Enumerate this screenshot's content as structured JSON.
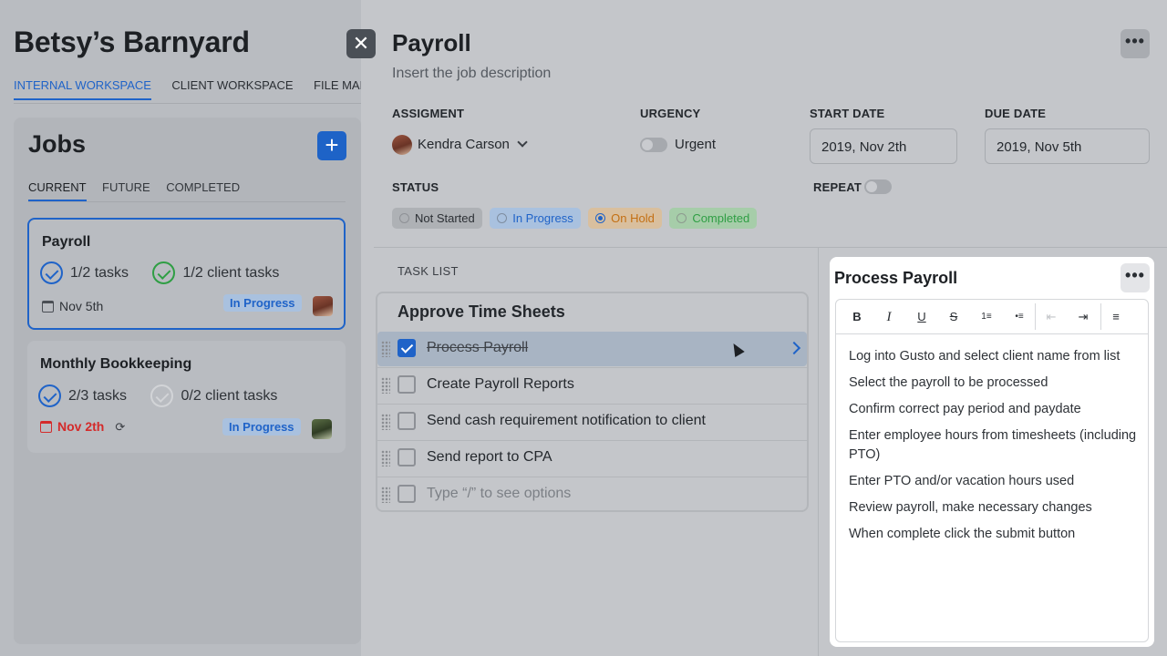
{
  "company": {
    "name": "Betsy’s Barnyard"
  },
  "workspace_tabs": [
    {
      "label": "INTERNAL WORKSPACE",
      "active": true
    },
    {
      "label": "CLIENT WORKSPACE",
      "active": false
    },
    {
      "label": "FILE MANAGER",
      "active": false
    }
  ],
  "jobs": {
    "title": "Jobs",
    "add_icon": "plus-icon",
    "tabs": [
      {
        "label": "CURRENT",
        "active": true
      },
      {
        "label": "FUTURE",
        "active": false
      },
      {
        "label": "COMPLETED",
        "active": false
      }
    ],
    "cards": [
      {
        "name": "Payroll",
        "tasks": "1/2 tasks",
        "client_tasks": "1/2 client tasks",
        "date": "Nov 5th",
        "status": "In Progress",
        "selected": true
      },
      {
        "name": "Monthly Bookkeeping",
        "tasks": "2/3 tasks",
        "client_tasks": "0/2 client tasks",
        "date": "Nov 2th",
        "status": "In Progress",
        "overdue": true,
        "repeat_icon": "repeat-icon"
      }
    ]
  },
  "drawer": {
    "title": "Payroll",
    "description": "Insert the job description",
    "close_icon": "close-icon",
    "more_icon": "more-horizontal-icon",
    "assignment": {
      "label": "ASSIGMENT",
      "name": "Kendra Carson"
    },
    "urgency": {
      "label": "URGENCY",
      "toggle_label": "Urgent",
      "on": false
    },
    "start_date": {
      "label": "START DATE",
      "value": "2019, Nov 2th"
    },
    "due_date": {
      "label": "DUE DATE",
      "value": "2019, Nov 5th"
    },
    "status": {
      "label": "STATUS",
      "options": [
        "Not Started",
        "In Progress",
        "On Hold",
        "Completed"
      ],
      "selected": "On Hold"
    },
    "repeat": {
      "label": "REPEAT",
      "on": false
    },
    "task_list": {
      "label": "TASK LIST",
      "group": "Approve Time Sheets",
      "tasks": [
        {
          "text": "Process Payroll",
          "checked": true
        },
        {
          "text": "Create Payroll Reports",
          "checked": false
        },
        {
          "text": "Send cash requirement notification to client",
          "checked": false
        },
        {
          "text": "Send report to CPA",
          "checked": false
        }
      ],
      "placeholder": "Type “/” to see options"
    }
  },
  "detail": {
    "title": "Process Payroll",
    "toolbar": [
      "B",
      "I",
      "U",
      "S",
      "1≡",
      "•≡",
      "⇤",
      "⇥",
      "≡"
    ],
    "steps": [
      "Log into Gusto and select client name from list",
      "Select the payroll to be processed",
      "Confirm correct pay period and paydate",
      "Enter employee hours from timesheets (including PTO)",
      "Enter PTO and/or vacation hours used",
      "Review payroll, make necessary changes",
      "When complete click the submit button"
    ]
  },
  "colors": {
    "accent": "#1f63c8",
    "on_hold": "#c36f13",
    "completed": "#2f9e44",
    "overdue": "#d42a2a"
  }
}
